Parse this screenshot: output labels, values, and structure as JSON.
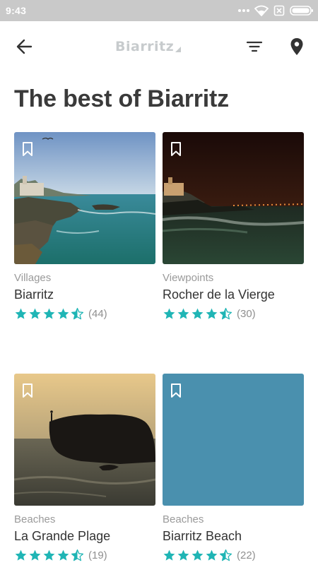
{
  "status_bar": {
    "time": "9:43",
    "icons": [
      "dots-icon",
      "wifi-icon",
      "no-sim-icon",
      "battery-icon"
    ]
  },
  "header": {
    "logo_text": "Biarritz",
    "icons": [
      "back-arrow-icon",
      "filter-icon",
      "map-pin-icon"
    ]
  },
  "page": {
    "title": "The best of Biarritz"
  },
  "colors": {
    "accent": "#1fb5b5",
    "title": "#3a3a3a",
    "status_bar": "#c9c9c9"
  },
  "cards": [
    {
      "category": "Villages",
      "name": "Biarritz",
      "rating": 4.5,
      "reviews": "(44)"
    },
    {
      "category": "Viewpoints",
      "name": "Rocher de la Vierge",
      "rating": 4.5,
      "reviews": "(30)"
    },
    {
      "category": "Beaches",
      "name": "La Grande Plage",
      "rating": 4.5,
      "reviews": "(19)"
    },
    {
      "category": "Beaches",
      "name": "Biarritz Beach",
      "rating": 4.5,
      "reviews": "(22)"
    }
  ]
}
